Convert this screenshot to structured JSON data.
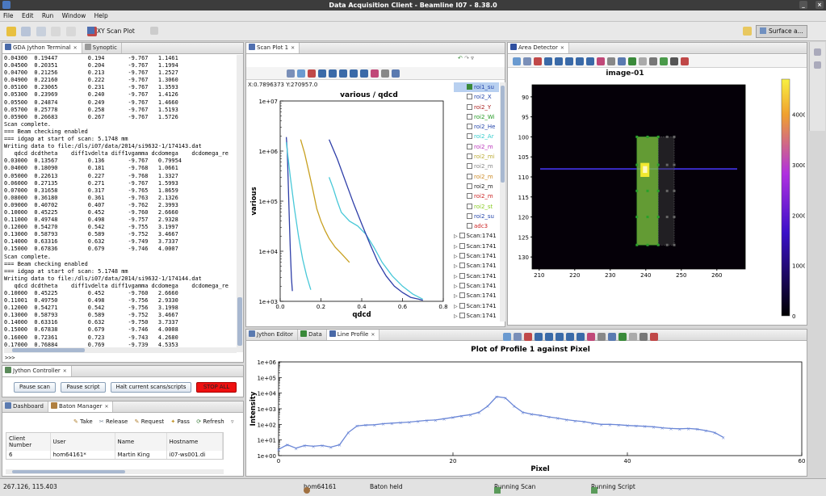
{
  "window": {
    "title": "Data Acquisition Client - Beamline I07 - 8.38.0"
  },
  "menu": [
    "File",
    "Edit",
    "Run",
    "Window",
    "Help"
  ],
  "toolbar": {
    "scan_plot_label": "XY Scan Plot",
    "perspective_label": "Surface a..."
  },
  "terminal": {
    "tabs": [
      "GDA Jython Terminal",
      "Synoptic"
    ],
    "lines": [
      "0.04300  0.19447         0.194       -9.767   1.1461",
      "0.04500  0.20351         0.204       -9.767   1.1994",
      "0.04700  0.21256         0.213       -9.767   1.2527",
      "0.04900  0.22160         0.222       -9.767   1.3060",
      "0.05100  0.23065         0.231       -9.767   1.3593",
      "0.05300  0.23969         0.240       -9.767   1.4126",
      "0.05500  0.24874         0.249       -9.767   1.4660",
      "0.05700  0.25778         0.258       -9.767   1.5193",
      "0.05900  0.26683         0.267       -9.767   1.5726",
      "Scan complete.",
      "=== Beam checking enabled",
      "=== idgap at start of scan: 5.1748 mm",
      "Writing data to file:/dls/i07/data/2014/si9632-1/174143.dat",
      "   qdcd dcdtheta    diff1vdelta diff1vgamma dcdomega    dcdomega_re",
      "0.03000  0.13567         0.136       -9.767   0.79954",
      "0.04000  0.18090         0.181       -9.768   1.0661",
      "0.05000  0.22613         0.227       -9.768   1.3327",
      "0.06000  0.27135         0.271       -9.767   1.5993",
      "0.07000  0.31658         0.317       -9.765   1.8659",
      "0.08000  0.36180         0.361       -9.763   2.1326",
      "0.09000  0.40702         0.407       -9.762   2.3993",
      "0.10000  0.45225         0.452       -9.760   2.6660",
      "0.11000  0.49748         0.498       -9.757   2.9328",
      "0.12000  0.54270         0.542       -9.755   3.1997",
      "0.13000  0.58793         0.589       -9.752   3.4667",
      "0.14000  0.63316         0.632       -9.749   3.7337",
      "0.15000  0.67836         0.679       -9.746   4.0007",
      "Scan complete.",
      "=== Beam checking enabled",
      "=== idgap at start of scan: 5.1748 mm",
      "Writing data to file:/dls/i07/data/2014/si9632-1/174144.dat",
      "   qdcd dcdtheta    diff1vdelta diff1vgamma dcdomega    dcdomega_re",
      "0.10000  0.45225         0.452       -9.760   2.6660",
      "0.11001  0.49750         0.498       -9.756   2.9330",
      "0.12000  0.54271         0.542       -9.756   3.1998",
      "0.13000  0.58793         0.589       -9.752   3.4667",
      "0.14000  0.63316         0.632       -9.750   3.7337",
      "0.15000  0.67838         0.679       -9.746   4.0008",
      "0.16000  0.72361         0.723       -9.743   4.2680",
      "0.17000  0.76884         0.769       -9.739   4.5353"
    ],
    "prompt": ">>>"
  },
  "jython_controller": {
    "tab": "Jython Controller",
    "pause_scan": "Pause scan",
    "pause_script": "Pause script",
    "halt": "Halt current scans/scripts",
    "stop_all": "STOP ALL"
  },
  "baton": {
    "tabs": [
      "Dashboard",
      "Baton Manager"
    ],
    "actions": [
      "Take",
      "Release",
      "Request",
      "Pass",
      "Refresh"
    ],
    "headers": [
      "Client Number",
      "User",
      "Name",
      "Hostname"
    ],
    "rows": [
      [
        "6",
        "hom64161*",
        "Martin King",
        "i07-ws001.di"
      ]
    ]
  },
  "scan_plot": {
    "tab": "Scan Plot 1",
    "coords": "X:0.7896373 Y:270957.0",
    "legend": [
      {
        "label": "roi1_su",
        "checked": true,
        "color": "#2244aa"
      },
      {
        "label": "roi2_X",
        "checked": false,
        "color": "#2244aa"
      },
      {
        "label": "roi2_Y",
        "checked": false,
        "color": "#aa2222"
      },
      {
        "label": "roi2_Wi",
        "checked": false,
        "color": "#229922"
      },
      {
        "label": "roi2_He",
        "checked": false,
        "color": "#2244aa"
      },
      {
        "label": "roi2_Ar",
        "checked": false,
        "color": "#33cccc"
      },
      {
        "label": "roi2_m",
        "checked": false,
        "color": "#bb33bb"
      },
      {
        "label": "roi2_mi",
        "checked": false,
        "color": "#bbaa33"
      },
      {
        "label": "roi2_m",
        "checked": false,
        "color": "#888888"
      },
      {
        "label": "roi2_m",
        "checked": false,
        "color": "#cc8822"
      },
      {
        "label": "roi2_m",
        "checked": false,
        "color": "#222222"
      },
      {
        "label": "roi2_m",
        "checked": false,
        "color": "#cc2222"
      },
      {
        "label": "roi2_st",
        "checked": false,
        "color": "#88cc22"
      },
      {
        "label": "roi2_su",
        "checked": false,
        "color": "#2244aa"
      },
      {
        "label": "adc3",
        "checked": false,
        "color": "#cc2222"
      },
      {
        "label": "Scan:1741",
        "checked": false,
        "color": "#111111"
      },
      {
        "label": "Scan:1741",
        "checked": false,
        "color": "#111111"
      },
      {
        "label": "Scan:1741",
        "checked": false,
        "color": "#111111"
      },
      {
        "label": "Scan:1741",
        "checked": false,
        "color": "#111111"
      },
      {
        "label": "Scan:1741",
        "checked": false,
        "color": "#111111"
      },
      {
        "label": "Scan:1741",
        "checked": false,
        "color": "#111111"
      },
      {
        "label": "Scan:1741",
        "checked": false,
        "color": "#111111"
      },
      {
        "label": "Scan:1741",
        "checked": false,
        "color": "#111111"
      },
      {
        "label": "Scan:1741",
        "checked": false,
        "color": "#111111"
      }
    ]
  },
  "area_detector": {
    "tab": "Area Detector",
    "image_title": "image-01",
    "x_ticks": [
      "210",
      "220",
      "230",
      "240",
      "250",
      "260"
    ],
    "y_ticks": [
      "90",
      "95",
      "100",
      "105",
      "110",
      "115",
      "120",
      "125",
      "130"
    ],
    "colorbar_ticks": [
      "4000",
      "3000",
      "2000",
      "1000",
      "0"
    ]
  },
  "bottom_tabs": [
    "Jython Editor",
    "Data",
    "Line Profile"
  ],
  "chart_data": [
    {
      "type": "line",
      "title": "various / qdcd",
      "xlabel": "qdcd",
      "ylabel": "various",
      "log_y": true,
      "xlim": [
        0,
        0.8
      ],
      "ylim": [
        1000,
        10000000
      ],
      "x_ticks": [
        "0.0",
        "0.2",
        "0.4",
        "0.6",
        "0.8"
      ],
      "y_ticks": [
        "1e+07",
        "1e+06",
        "1e+05",
        "1e+04",
        "1e+03"
      ],
      "series": [
        {
          "color": "#2e3ea8",
          "x": [
            0.03,
            0.035,
            0.04,
            0.045,
            0.05,
            0.055,
            0.06
          ],
          "y": [
            1900000,
            1000000,
            200000,
            40000,
            10000,
            3000,
            1600
          ]
        },
        {
          "color": "#48c8d8",
          "x": [
            0.03,
            0.05,
            0.07,
            0.09,
            0.11,
            0.13,
            0.15
          ],
          "y": [
            1500000,
            300000,
            70000,
            20000,
            7000,
            3200,
            1700
          ]
        },
        {
          "color": "#c8a020",
          "x": [
            0.1,
            0.12,
            0.14,
            0.16,
            0.18,
            0.2,
            0.22,
            0.24,
            0.27,
            0.3,
            0.34
          ],
          "y": [
            1700000,
            900000,
            400000,
            170000,
            70000,
            40000,
            26000,
            18000,
            12000,
            9000,
            6000
          ]
        },
        {
          "color": "#48c8d8",
          "x": [
            0.24,
            0.26,
            0.28,
            0.3,
            0.34,
            0.38,
            0.42,
            0.46,
            0.5,
            0.55,
            0.6,
            0.65,
            0.7
          ],
          "y": [
            300000,
            180000,
            100000,
            60000,
            40000,
            32000,
            22000,
            12000,
            6000,
            3200,
            2000,
            1400,
            1100
          ]
        },
        {
          "color": "#2e3ea8",
          "x": [
            0.24,
            0.28,
            0.32,
            0.36,
            0.4,
            0.44,
            0.48,
            0.52,
            0.56,
            0.6,
            0.64,
            0.68,
            0.7
          ],
          "y": [
            1700000,
            700000,
            250000,
            90000,
            35000,
            14000,
            6000,
            3200,
            2000,
            1500,
            1200,
            1100,
            1050
          ]
        }
      ]
    },
    {
      "type": "line",
      "title": "Plot of Profile 1 against Pixel",
      "xlabel": "Pixel",
      "ylabel": "Intensity",
      "log_y": true,
      "xlim": [
        0,
        60
      ],
      "ylim": [
        1,
        1000000
      ],
      "x_ticks": [
        "0",
        "20",
        "40",
        "60"
      ],
      "y_ticks": [
        "1e+06",
        "1e+05",
        "1e+04",
        "1e+03",
        "1e+02",
        "1e+01",
        "1e+00"
      ],
      "series": [
        {
          "color": "#6a86d6",
          "x": [
            0,
            1,
            2,
            3,
            4,
            5,
            6,
            7,
            8,
            9,
            10,
            11,
            12,
            13,
            14,
            15,
            16,
            17,
            18,
            19,
            20,
            21,
            22,
            23,
            24,
            25,
            26,
            27,
            28,
            29,
            30,
            31,
            32,
            33,
            34,
            35,
            36,
            37,
            38,
            39,
            40,
            41,
            42,
            43,
            44,
            45,
            46,
            47,
            48,
            49,
            50,
            51
          ],
          "y": [
            2.5,
            5,
            3,
            4.5,
            4,
            4.5,
            3.5,
            5,
            30,
            80,
            90,
            95,
            110,
            120,
            130,
            140,
            160,
            180,
            190,
            230,
            280,
            350,
            420,
            600,
            1500,
            6000,
            5000,
            1500,
            600,
            450,
            380,
            300,
            250,
            200,
            170,
            150,
            120,
            100,
            100,
            95,
            85,
            80,
            75,
            70,
            60,
            55,
            52,
            55,
            50,
            40,
            30,
            15
          ]
        }
      ]
    }
  ]
}
